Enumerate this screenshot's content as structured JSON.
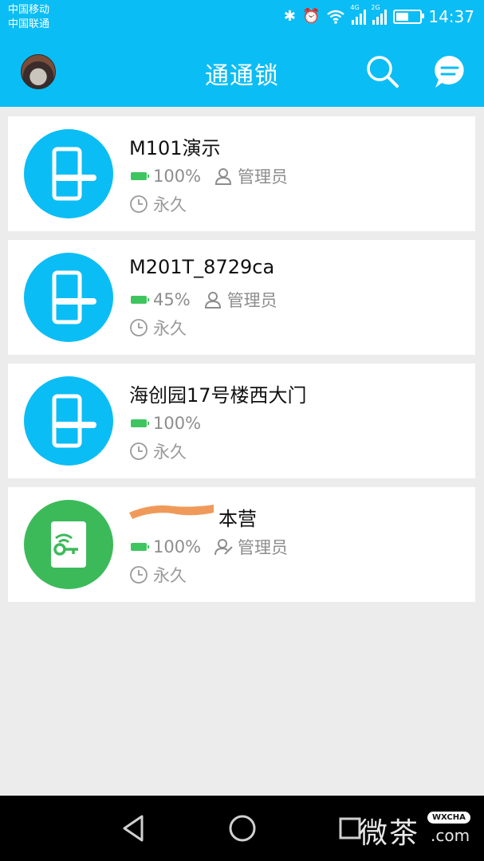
{
  "status_bar": {
    "carrier1": "中国移动",
    "carrier2": "中国联通",
    "net1": "4G",
    "net2": "2G",
    "time": "14:37",
    "battery_level": 0.55
  },
  "app_bar": {
    "title": "通通锁",
    "icons": [
      "avatar",
      "search-icon",
      "message-icon"
    ]
  },
  "locks": [
    {
      "name": "M101演示",
      "battery": "100%",
      "role": "管理员",
      "validity": "永久",
      "color": "#0bbdf5",
      "icon": "door-lock-icon"
    },
    {
      "name": "M201T_8729ca",
      "battery": "45%",
      "role": "管理员",
      "validity": "永久",
      "color": "#0bbdf5",
      "icon": "door-lock-icon"
    },
    {
      "name": "海创园17号楼西大门",
      "battery": "100%",
      "role": "",
      "validity": "永久",
      "color": "#0bbdf5",
      "icon": "door-lock-icon"
    },
    {
      "name": "本营",
      "battery": "100%",
      "role": "管理员",
      "validity": "永久",
      "color": "#3cba5a",
      "icon": "key-lock-icon"
    }
  ],
  "colors": {
    "primary": "#0bbdf5",
    "battery_green": "#3fc55f",
    "lock_green": "#3cba5a"
  },
  "watermark": {
    "text": "微茶",
    "badge": "WXCHA",
    "suffix": ".com"
  }
}
